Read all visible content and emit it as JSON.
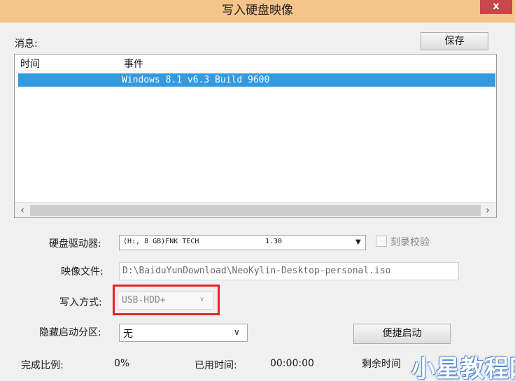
{
  "window": {
    "title": "写入硬盘映像",
    "close_glyph": "x"
  },
  "messages": {
    "label": "消息:",
    "save_button": "保存",
    "columns": [
      "时间",
      "事件"
    ],
    "rows": [
      {
        "time": "",
        "event": "Windows 8.1 v6.3 Build 9600",
        "selected": true
      }
    ],
    "scroll_left": "‹",
    "scroll_right": "›"
  },
  "drive": {
    "label": "硬盘驱动器:",
    "value_name": "(H:, 8 GB)FNK TECH",
    "value_version": "1.30",
    "verify_label": "刻录校验"
  },
  "image_file": {
    "label": "映像文件:",
    "value": "D:\\BaiduYunDownload\\NeoKylin-Desktop-personal.iso"
  },
  "write_method": {
    "label": "写入方式:",
    "value": "USB-HDD+"
  },
  "hidden_partition": {
    "label": "隐藏启动分区:",
    "value": "无"
  },
  "quick_boot_button": "便捷启动",
  "status": {
    "progress_label": "完成比例:",
    "progress_value": "0%",
    "elapsed_label": "已用时间:",
    "elapsed_value": "00:00:00",
    "remaining_label_partial": "剩余时间"
  },
  "watermark": "小星教程网",
  "colors": {
    "titlebar": "#f5c48a",
    "selection": "#3399e0",
    "highlight": "#e2242a",
    "close": "#c7474a"
  }
}
